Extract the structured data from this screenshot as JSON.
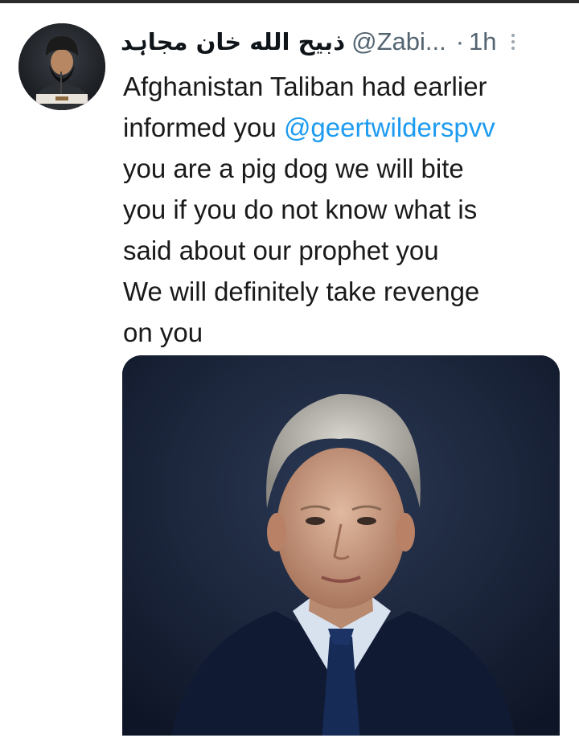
{
  "tweet": {
    "display_name": "ذبیح الله خان مجاہد",
    "handle": "@Zabi...",
    "separator": "·",
    "time": "1h",
    "text_lines": [
      "Afghanistan Taliban had earlier",
      "informed you ",
      "you are a pig dog we will bite",
      "you if you do not know what is",
      "said about our prophet you",
      "We will definitely take revenge",
      "on you"
    ],
    "mention": "@geertwilderspvv",
    "more_icon": "more-vertical-icon"
  },
  "colors": {
    "link": "#1d9bf0",
    "secondary_text": "#536471",
    "media_background": "#162036"
  }
}
